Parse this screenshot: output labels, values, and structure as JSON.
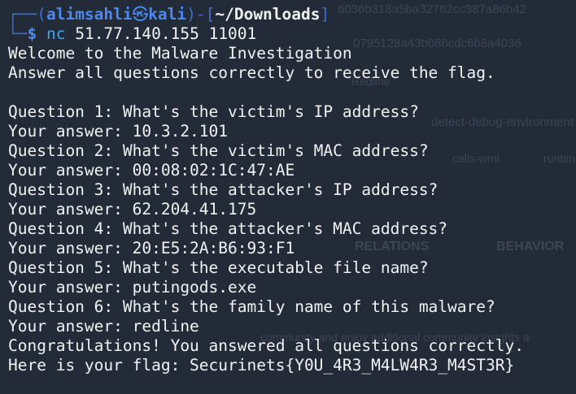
{
  "prompt": {
    "open_bracket": "┌──(",
    "user": "alimsahli",
    "at_icon": "㉿",
    "host": "kali",
    "close_bracket": ")-[",
    "path": "~/Downloads",
    "end_bracket": "]",
    "corner": "└─",
    "dollar": "$",
    "command": "nc",
    "args": " 51.77.140.155 11001"
  },
  "output": {
    "welcome": "Welcome to the Malware Investigation",
    "instructions": "Answer all questions correctly to receive the flag.",
    "qa": [
      {
        "question": "Question 1: What's the victim's IP address?",
        "answer": "Your answer: 10.3.2.101"
      },
      {
        "question": "Question 2: What's the victim's MAC address?",
        "answer": "Your answer: 00:08:02:1C:47:AE"
      },
      {
        "question": "Question 3: What's the attacker's IP address?",
        "answer": "Your answer: 62.204.41.175"
      },
      {
        "question": "Question 4: What's the attacker's MAC address?",
        "answer": "Your answer: 20:E5:2A:B6:93:F1"
      },
      {
        "question": "Question 5: What's the executable file name?",
        "answer": "Your answer: putingods.exe"
      },
      {
        "question": "Question 6: What's the family name of this malware?",
        "answer": "Your answer: redline"
      }
    ],
    "congrats": "Congratulations! You answered all questions correctly.",
    "flag": "Here is your flag: Securinets{Y0U_4R3_M4LW4R3_M4ST3R}"
  },
  "background": {
    "hash1": "6036b318a5ba32762cc387a86b42",
    "hash2": "0795128a43b086cdc6b8a4036",
    "ident": "Redline",
    "tag1": "detect-debug-environment",
    "tag2": "calls-wmi",
    "tag3": "runtime",
    "relations": "RELATIONS",
    "behavior": "BEHAVIOR",
    "community": "community and enjoy additional community insights a"
  }
}
